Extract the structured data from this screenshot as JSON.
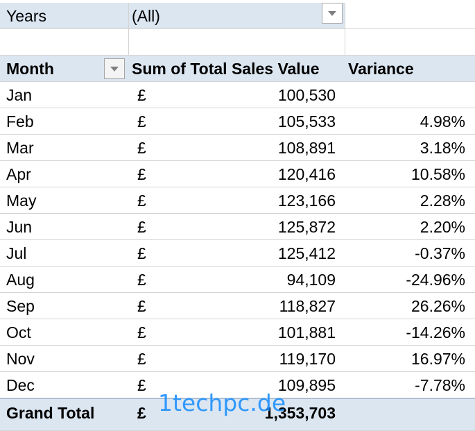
{
  "filter": {
    "label": "Years",
    "value": "(All)"
  },
  "headers": {
    "month": "Month",
    "sum": "Sum of Total Sales Value",
    "variance": "Variance"
  },
  "rows": [
    {
      "month": "Jan",
      "currency": "£",
      "value": "100,530",
      "variance": ""
    },
    {
      "month": "Feb",
      "currency": "£",
      "value": "105,533",
      "variance": "4.98%"
    },
    {
      "month": "Mar",
      "currency": "£",
      "value": "108,891",
      "variance": "3.18%"
    },
    {
      "month": "Apr",
      "currency": "£",
      "value": "120,416",
      "variance": "10.58%"
    },
    {
      "month": "May",
      "currency": "£",
      "value": "123,166",
      "variance": "2.28%"
    },
    {
      "month": "Jun",
      "currency": "£",
      "value": "125,872",
      "variance": "2.20%"
    },
    {
      "month": "Jul",
      "currency": "£",
      "value": "125,412",
      "variance": "-0.37%"
    },
    {
      "month": "Aug",
      "currency": "£",
      "value": "94,109",
      "variance": "-24.96%"
    },
    {
      "month": "Sep",
      "currency": "£",
      "value": "118,827",
      "variance": "26.26%"
    },
    {
      "month": "Oct",
      "currency": "£",
      "value": "101,881",
      "variance": "-14.26%"
    },
    {
      "month": "Nov",
      "currency": "£",
      "value": "119,170",
      "variance": "16.97%"
    },
    {
      "month": "Dec",
      "currency": "£",
      "value": "109,895",
      "variance": "-7.78%"
    }
  ],
  "grand_total": {
    "label": "Grand Total",
    "currency": "£",
    "value": "1,353,703"
  },
  "watermark": "1techpc.de",
  "colors": {
    "header_fill": "#dce6f1",
    "gridline": "#d4d4d4",
    "watermark": "#1e90ff"
  },
  "icons": {
    "filter_dropdown": "chevron-down-icon"
  }
}
